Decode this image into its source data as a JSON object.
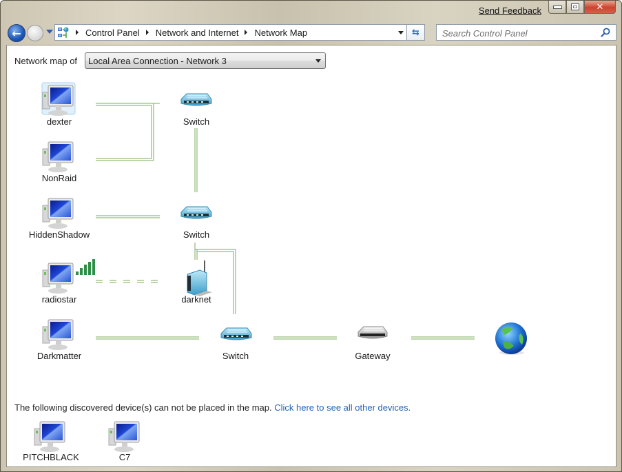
{
  "window": {
    "send_feedback": "Send Feedback",
    "caption": {
      "minimize": "minimize",
      "maximize": "maximize",
      "close": "✕"
    }
  },
  "navbar": {
    "back_glyph": "←",
    "breadcrumb": [
      "Control Panel",
      "Network and Internet",
      "Network Map"
    ],
    "refresh_glyph": "⇆",
    "search_placeholder": "Search Control Panel"
  },
  "main": {
    "map_of_label": "Network map of",
    "selected_network": "Local Area Connection - Network  3",
    "nodes": {
      "dexter": "dexter",
      "nonraid": "NonRaid",
      "hiddenshadow": "HiddenShadow",
      "radiostar": "radiostar",
      "darkmatter": "Darkmatter",
      "switch1": "Switch",
      "switch2": "Switch",
      "darknet": "darknet",
      "switch3": "Switch",
      "gateway": "Gateway",
      "internet": ""
    },
    "footer_text": "The following discovered device(s) can not be placed in the map.",
    "footer_link": "Click here to see all other devices.",
    "unplaced_devices": [
      "PITCHBLACK",
      "C7"
    ]
  },
  "colors": {
    "link_line": "#78ad5a",
    "link": "#1f64b7",
    "close_button": "#c9452e"
  }
}
